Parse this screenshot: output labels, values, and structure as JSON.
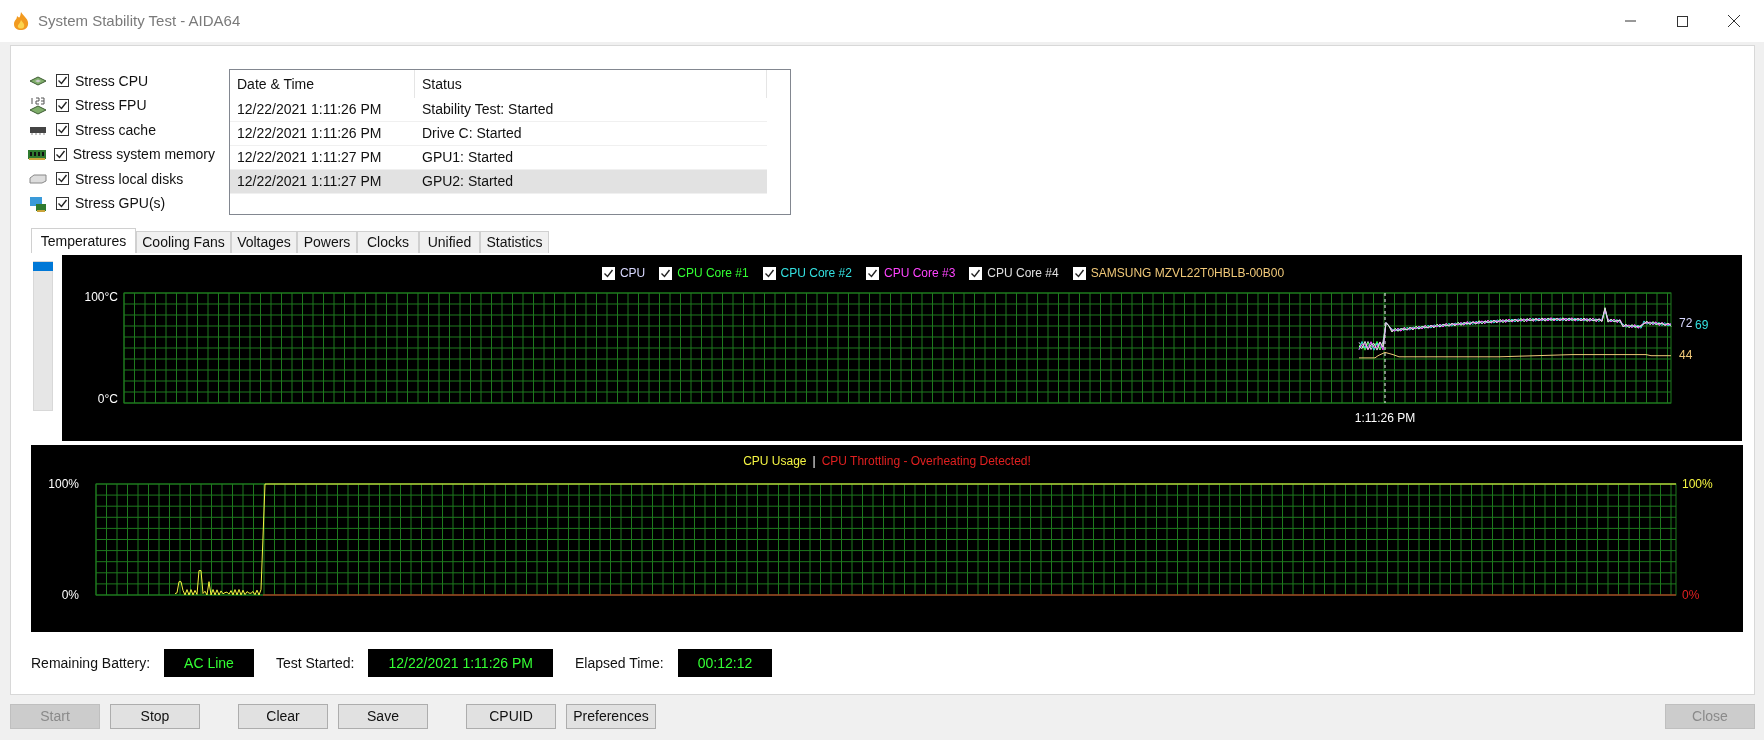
{
  "window": {
    "title": "System Stability Test - AIDA64"
  },
  "stress_options": [
    {
      "kind": "cpu",
      "label": "Stress CPU",
      "checked": true
    },
    {
      "kind": "fpu",
      "label": "Stress FPU",
      "checked": true
    },
    {
      "kind": "cache",
      "label": "Stress cache",
      "checked": true
    },
    {
      "kind": "memory",
      "label": "Stress system memory",
      "checked": true
    },
    {
      "kind": "disk",
      "label": "Stress local disks",
      "checked": true
    },
    {
      "kind": "gpu",
      "label": "Stress GPU(s)",
      "checked": true
    }
  ],
  "log": {
    "columns": [
      "Date & Time",
      "Status"
    ],
    "rows": [
      {
        "date_time": "12/22/2021 1:11:26 PM",
        "status": "Stability Test: Started",
        "selected": false
      },
      {
        "date_time": "12/22/2021 1:11:26 PM",
        "status": "Drive C: Started",
        "selected": false
      },
      {
        "date_time": "12/22/2021 1:11:27 PM",
        "status": "GPU1: Started",
        "selected": false
      },
      {
        "date_time": "12/22/2021 1:11:27 PM",
        "status": "GPU2: Started",
        "selected": true
      }
    ]
  },
  "tabs": [
    {
      "label": "Temperatures",
      "selected": true
    },
    {
      "label": "Cooling Fans",
      "selected": false
    },
    {
      "label": "Voltages",
      "selected": false
    },
    {
      "label": "Powers",
      "selected": false
    },
    {
      "label": "Clocks",
      "selected": false
    },
    {
      "label": "Unified",
      "selected": false
    },
    {
      "label": "Statistics",
      "selected": false
    }
  ],
  "temperature_chart": {
    "legend": [
      {
        "label": "CPU",
        "checked": true,
        "color": "#d8d8ff"
      },
      {
        "label": "CPU Core #1",
        "checked": true,
        "color": "#33ff33"
      },
      {
        "label": "CPU Core #2",
        "checked": true,
        "color": "#33e0e0"
      },
      {
        "label": "CPU Core #3",
        "checked": true,
        "color": "#ff44ff"
      },
      {
        "label": "CPU Core #4",
        "checked": true,
        "color": "#e0e0e0"
      },
      {
        "label": "SAMSUNG MZVL22T0HBLB-00B00",
        "checked": true,
        "color": "#f0c878"
      }
    ],
    "y_max_label": "100°C",
    "y_min_label": "0°C",
    "time_label": "1:11:26 PM",
    "readings": [
      {
        "text": "72",
        "color": "#d8d8ff"
      },
      {
        "text": "69",
        "color": "#33e0e0"
      },
      {
        "text": "44",
        "color": "#f0c878"
      }
    ]
  },
  "cpu_chart": {
    "usage_title": "CPU Usage",
    "separator": "|",
    "throttling_title": "CPU Throttling - Overheating Detected!",
    "left_max": "100%",
    "left_min": "0%",
    "right_max": "100%",
    "right_min": "0%"
  },
  "status_fields": [
    {
      "label": "Remaining Battery:",
      "value": "AC Line"
    },
    {
      "label": "Test Started:",
      "value": "12/22/2021 1:11:26 PM"
    },
    {
      "label": "Elapsed Time:",
      "value": "00:12:12"
    }
  ],
  "buttons": [
    {
      "label": "Start",
      "disabled": true
    },
    {
      "label": "Stop",
      "disabled": false
    },
    {
      "label": "Clear",
      "disabled": false
    },
    {
      "label": "Save",
      "disabled": false
    },
    {
      "label": "CPUID",
      "disabled": false
    },
    {
      "label": "Preferences",
      "disabled": false
    },
    {
      "label": "Close",
      "disabled": true
    }
  ]
}
